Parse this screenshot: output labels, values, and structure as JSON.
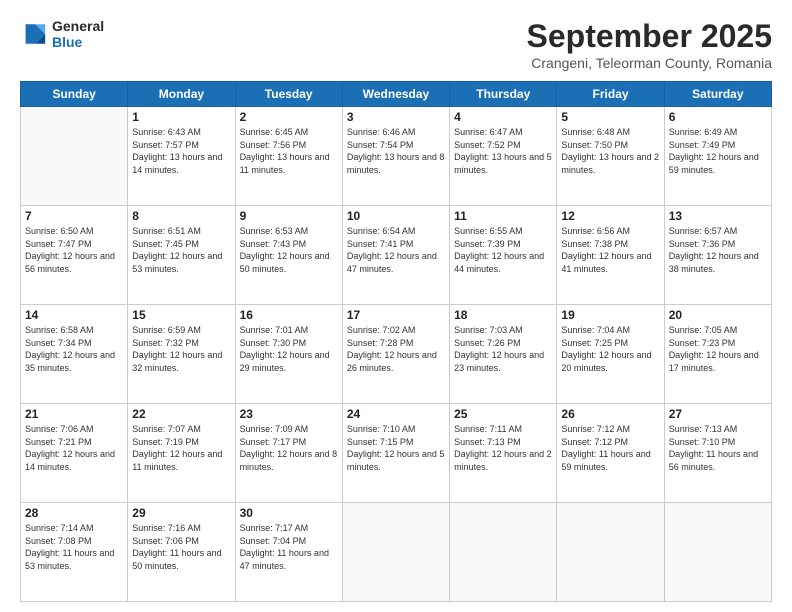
{
  "header": {
    "logo_line1": "General",
    "logo_line2": "Blue",
    "month": "September 2025",
    "location": "Crangeni, Teleorman County, Romania"
  },
  "weekdays": [
    "Sunday",
    "Monday",
    "Tuesday",
    "Wednesday",
    "Thursday",
    "Friday",
    "Saturday"
  ],
  "weeks": [
    [
      {
        "day": "",
        "sunrise": "",
        "sunset": "",
        "daylight": ""
      },
      {
        "day": "1",
        "sunrise": "Sunrise: 6:43 AM",
        "sunset": "Sunset: 7:57 PM",
        "daylight": "Daylight: 13 hours and 14 minutes."
      },
      {
        "day": "2",
        "sunrise": "Sunrise: 6:45 AM",
        "sunset": "Sunset: 7:56 PM",
        "daylight": "Daylight: 13 hours and 11 minutes."
      },
      {
        "day": "3",
        "sunrise": "Sunrise: 6:46 AM",
        "sunset": "Sunset: 7:54 PM",
        "daylight": "Daylight: 13 hours and 8 minutes."
      },
      {
        "day": "4",
        "sunrise": "Sunrise: 6:47 AM",
        "sunset": "Sunset: 7:52 PM",
        "daylight": "Daylight: 13 hours and 5 minutes."
      },
      {
        "day": "5",
        "sunrise": "Sunrise: 6:48 AM",
        "sunset": "Sunset: 7:50 PM",
        "daylight": "Daylight: 13 hours and 2 minutes."
      },
      {
        "day": "6",
        "sunrise": "Sunrise: 6:49 AM",
        "sunset": "Sunset: 7:49 PM",
        "daylight": "Daylight: 12 hours and 59 minutes."
      }
    ],
    [
      {
        "day": "7",
        "sunrise": "Sunrise: 6:50 AM",
        "sunset": "Sunset: 7:47 PM",
        "daylight": "Daylight: 12 hours and 56 minutes."
      },
      {
        "day": "8",
        "sunrise": "Sunrise: 6:51 AM",
        "sunset": "Sunset: 7:45 PM",
        "daylight": "Daylight: 12 hours and 53 minutes."
      },
      {
        "day": "9",
        "sunrise": "Sunrise: 6:53 AM",
        "sunset": "Sunset: 7:43 PM",
        "daylight": "Daylight: 12 hours and 50 minutes."
      },
      {
        "day": "10",
        "sunrise": "Sunrise: 6:54 AM",
        "sunset": "Sunset: 7:41 PM",
        "daylight": "Daylight: 12 hours and 47 minutes."
      },
      {
        "day": "11",
        "sunrise": "Sunrise: 6:55 AM",
        "sunset": "Sunset: 7:39 PM",
        "daylight": "Daylight: 12 hours and 44 minutes."
      },
      {
        "day": "12",
        "sunrise": "Sunrise: 6:56 AM",
        "sunset": "Sunset: 7:38 PM",
        "daylight": "Daylight: 12 hours and 41 minutes."
      },
      {
        "day": "13",
        "sunrise": "Sunrise: 6:57 AM",
        "sunset": "Sunset: 7:36 PM",
        "daylight": "Daylight: 12 hours and 38 minutes."
      }
    ],
    [
      {
        "day": "14",
        "sunrise": "Sunrise: 6:58 AM",
        "sunset": "Sunset: 7:34 PM",
        "daylight": "Daylight: 12 hours and 35 minutes."
      },
      {
        "day": "15",
        "sunrise": "Sunrise: 6:59 AM",
        "sunset": "Sunset: 7:32 PM",
        "daylight": "Daylight: 12 hours and 32 minutes."
      },
      {
        "day": "16",
        "sunrise": "Sunrise: 7:01 AM",
        "sunset": "Sunset: 7:30 PM",
        "daylight": "Daylight: 12 hours and 29 minutes."
      },
      {
        "day": "17",
        "sunrise": "Sunrise: 7:02 AM",
        "sunset": "Sunset: 7:28 PM",
        "daylight": "Daylight: 12 hours and 26 minutes."
      },
      {
        "day": "18",
        "sunrise": "Sunrise: 7:03 AM",
        "sunset": "Sunset: 7:26 PM",
        "daylight": "Daylight: 12 hours and 23 minutes."
      },
      {
        "day": "19",
        "sunrise": "Sunrise: 7:04 AM",
        "sunset": "Sunset: 7:25 PM",
        "daylight": "Daylight: 12 hours and 20 minutes."
      },
      {
        "day": "20",
        "sunrise": "Sunrise: 7:05 AM",
        "sunset": "Sunset: 7:23 PM",
        "daylight": "Daylight: 12 hours and 17 minutes."
      }
    ],
    [
      {
        "day": "21",
        "sunrise": "Sunrise: 7:06 AM",
        "sunset": "Sunset: 7:21 PM",
        "daylight": "Daylight: 12 hours and 14 minutes."
      },
      {
        "day": "22",
        "sunrise": "Sunrise: 7:07 AM",
        "sunset": "Sunset: 7:19 PM",
        "daylight": "Daylight: 12 hours and 11 minutes."
      },
      {
        "day": "23",
        "sunrise": "Sunrise: 7:09 AM",
        "sunset": "Sunset: 7:17 PM",
        "daylight": "Daylight: 12 hours and 8 minutes."
      },
      {
        "day": "24",
        "sunrise": "Sunrise: 7:10 AM",
        "sunset": "Sunset: 7:15 PM",
        "daylight": "Daylight: 12 hours and 5 minutes."
      },
      {
        "day": "25",
        "sunrise": "Sunrise: 7:11 AM",
        "sunset": "Sunset: 7:13 PM",
        "daylight": "Daylight: 12 hours and 2 minutes."
      },
      {
        "day": "26",
        "sunrise": "Sunrise: 7:12 AM",
        "sunset": "Sunset: 7:12 PM",
        "daylight": "Daylight: 11 hours and 59 minutes."
      },
      {
        "day": "27",
        "sunrise": "Sunrise: 7:13 AM",
        "sunset": "Sunset: 7:10 PM",
        "daylight": "Daylight: 11 hours and 56 minutes."
      }
    ],
    [
      {
        "day": "28",
        "sunrise": "Sunrise: 7:14 AM",
        "sunset": "Sunset: 7:08 PM",
        "daylight": "Daylight: 11 hours and 53 minutes."
      },
      {
        "day": "29",
        "sunrise": "Sunrise: 7:16 AM",
        "sunset": "Sunset: 7:06 PM",
        "daylight": "Daylight: 11 hours and 50 minutes."
      },
      {
        "day": "30",
        "sunrise": "Sunrise: 7:17 AM",
        "sunset": "Sunset: 7:04 PM",
        "daylight": "Daylight: 11 hours and 47 minutes."
      },
      {
        "day": "",
        "sunrise": "",
        "sunset": "",
        "daylight": ""
      },
      {
        "day": "",
        "sunrise": "",
        "sunset": "",
        "daylight": ""
      },
      {
        "day": "",
        "sunrise": "",
        "sunset": "",
        "daylight": ""
      },
      {
        "day": "",
        "sunrise": "",
        "sunset": "",
        "daylight": ""
      }
    ]
  ]
}
